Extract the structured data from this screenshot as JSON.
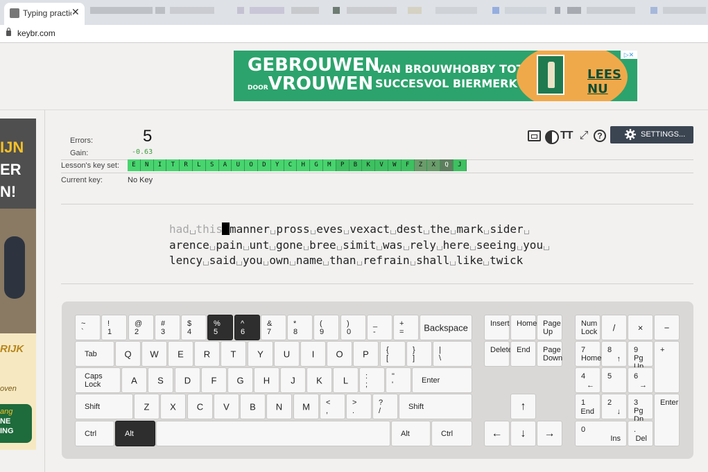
{
  "browser": {
    "tab_title": "Typing practic",
    "tab_close": "✕",
    "url": "keybr.com"
  },
  "ad_top": {
    "title_line1": "GEBROUWEN",
    "title_small": "DOOR",
    "title_line2": "VROUWEN",
    "slogan_line1": "VAN BROUWHOBBY TOT",
    "slogan_line2": "SUCCESVOL BIERMERK",
    "cta": "LEES NU",
    "choices": "▷✕"
  },
  "ad_side": {
    "text1": "IJN",
    "text2": "ER",
    "text3": "N!",
    "logo": "RIJK",
    "oven": "oven",
    "btn_top": "ang",
    "btn_mid": "NE",
    "btn_bottom": "ING"
  },
  "stats": {
    "errors_label": "Errors:",
    "errors_value": "5",
    "gain_label": "Gain:",
    "gain_value": "-0.63",
    "keyset_label": "Lesson's key set:",
    "current_key_label": "Current key:",
    "current_key_value": "No Key"
  },
  "key_set": [
    "E",
    "N",
    "I",
    "T",
    "R",
    "L",
    "S",
    "A",
    "U",
    "O",
    "D",
    "Y",
    "C",
    "H",
    "G",
    "M",
    "P",
    "B",
    "K",
    "V",
    "W",
    "F",
    "Z",
    "X",
    "Q",
    "J"
  ],
  "settings_label": "SETTINGS...",
  "typing": {
    "typed": [
      "had",
      "this"
    ],
    "line1": [
      "manner",
      "pross",
      "eves",
      "vexact",
      "dest",
      "the",
      "mark",
      "sider"
    ],
    "line2": [
      "arence",
      "pain",
      "unt",
      "gone",
      "bree",
      "simit",
      "was",
      "rely",
      "here",
      "seeing",
      "you"
    ],
    "line3": [
      "lency",
      "said",
      "you",
      "own",
      "name",
      "than",
      "refrain",
      "shall",
      "like",
      "twick"
    ]
  },
  "keyboard": {
    "row1": [
      [
        "~",
        "`"
      ],
      [
        "!",
        "1"
      ],
      [
        "@",
        "2"
      ],
      [
        "#",
        "3"
      ],
      [
        "$",
        "4"
      ],
      [
        "%",
        "5"
      ],
      [
        "^",
        "6"
      ],
      [
        "&",
        "7"
      ],
      [
        "*",
        "8"
      ],
      [
        "(",
        "9"
      ],
      [
        ")",
        "0"
      ],
      [
        "_",
        "-"
      ],
      [
        "+",
        "="
      ]
    ],
    "backspace": "Backspace",
    "tab": "Tab",
    "row2": [
      "Q",
      "W",
      "E",
      "R",
      "T",
      "Y",
      "U",
      "I",
      "O",
      "P"
    ],
    "row2_sym": [
      [
        "{",
        "["
      ],
      [
        "}",
        "]"
      ],
      [
        "|",
        "\\"
      ]
    ],
    "caps": "Caps Lock",
    "row3": [
      "A",
      "S",
      "D",
      "F",
      "G",
      "H",
      "J",
      "K",
      "L"
    ],
    "row3_sym": [
      [
        ":",
        ";"
      ],
      [
        "\"",
        "'"
      ]
    ],
    "enter": "Enter",
    "shift": "Shift",
    "row4": [
      "Z",
      "X",
      "C",
      "V",
      "B",
      "N",
      "M"
    ],
    "row4_sym": [
      [
        "<",
        ","
      ],
      [
        ">",
        "."
      ],
      [
        "?",
        "/"
      ]
    ],
    "ctrl": "Ctrl",
    "alt": "Alt",
    "nav": {
      "insert": "Insert",
      "home": "Home",
      "page_up_1": "Page",
      "page_up_2": "Up",
      "delete": "Delete",
      "end": "End",
      "page_down_1": "Page",
      "page_down_2": "Down",
      "up": "↑",
      "left": "←",
      "down": "↓",
      "right": "→"
    },
    "numpad": {
      "numlock_1": "Num",
      "numlock_2": "Lock",
      "divide": "/",
      "multiply": "×",
      "minus": "−",
      "n7": "7",
      "n7b": "Home",
      "n8": "8",
      "n8b": "↑",
      "n9": "9",
      "n9b": "Pg Up",
      "plus": "+",
      "n4": "4",
      "n4b": "←",
      "n5": "5",
      "n6": "6",
      "n6b": "→",
      "n1": "1",
      "n1b": "End",
      "n2": "2",
      "n2b": "↓",
      "n3": "3",
      "n3b": "Pg Dn",
      "enter": "Enter",
      "n0": "0",
      "n0b": "Ins",
      "dot": ".",
      "dotb": "Del"
    }
  }
}
